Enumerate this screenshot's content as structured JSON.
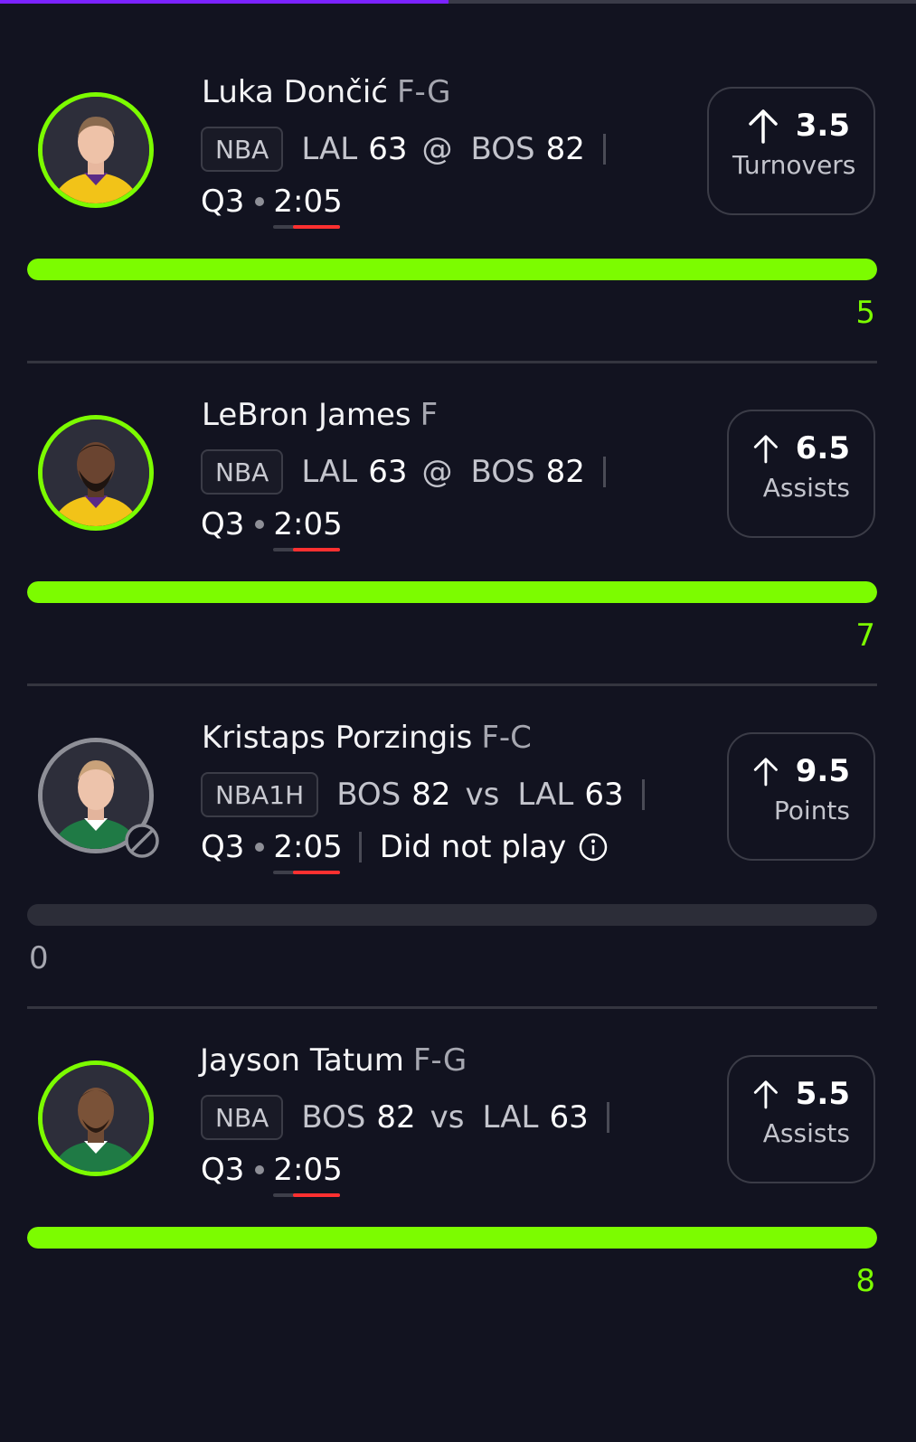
{
  "header_progress": {
    "fraction": 0.49,
    "color": "#7b22ff"
  },
  "colors": {
    "accent": "#7cfc00",
    "clock_red": "#ff3030",
    "inactive_ring": "#8e8f97"
  },
  "cards": [
    {
      "name": "Luka Dončić",
      "position": "F-G",
      "league": "NBA",
      "team1": "LAL",
      "score1": "63",
      "separator": "@",
      "team2": "BOS",
      "score2": "82",
      "quarter": "Q3",
      "clock": "2:05",
      "status": "",
      "line_value": "3.5",
      "line_direction": "up-arrow-icon",
      "stat": "Turnovers",
      "actual": "5",
      "progress_fraction": 1.0,
      "active": true
    },
    {
      "name": "LeBron James",
      "position": "F",
      "league": "NBA",
      "team1": "LAL",
      "score1": "63",
      "separator": "@",
      "team2": "BOS",
      "score2": "82",
      "quarter": "Q3",
      "clock": "2:05",
      "status": "",
      "line_value": "6.5",
      "line_direction": "up-arrow-icon",
      "stat": "Assists",
      "actual": "7",
      "progress_fraction": 1.0,
      "active": true
    },
    {
      "name": "Kristaps Porzingis",
      "position": "F-C",
      "league": "NBA1H",
      "team1": "BOS",
      "score1": "82",
      "separator": "vs",
      "team2": "LAL",
      "score2": "63",
      "quarter": "Q3",
      "clock": "2:05",
      "status": "Did not play",
      "line_value": "9.5",
      "line_direction": "up-arrow-icon",
      "stat": "Points",
      "actual": "0",
      "progress_fraction": 0.0,
      "active": false
    },
    {
      "name": "Jayson Tatum",
      "position": "F-G",
      "league": "NBA",
      "team1": "BOS",
      "score1": "82",
      "separator": "vs",
      "team2": "LAL",
      "score2": "63",
      "quarter": "Q3",
      "clock": "2:05",
      "status": "",
      "line_value": "5.5",
      "line_direction": "up-arrow-icon",
      "stat": "Assists",
      "actual": "8",
      "progress_fraction": 1.0,
      "active": true
    }
  ]
}
